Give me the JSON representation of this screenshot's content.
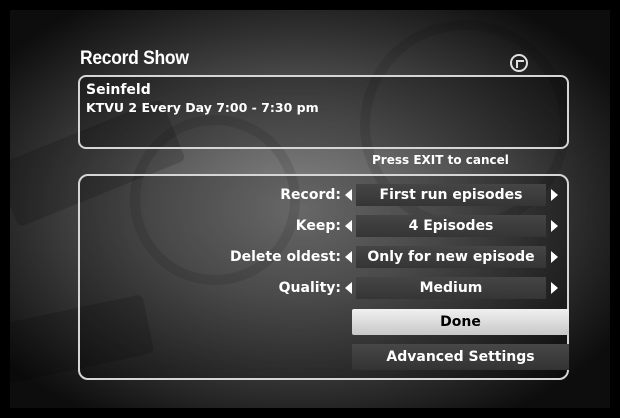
{
  "screen": {
    "title": "Record Show",
    "logo_icon": "tivo-logo-icon"
  },
  "show": {
    "name": "Seinfeld",
    "schedule": "KTVU 2 Every Day 7:00 - 7:30 pm"
  },
  "hint": "Press EXIT to cancel",
  "settings": [
    {
      "label": "Record:",
      "value": "First run episodes"
    },
    {
      "label": "Keep:",
      "value": "4 Episodes"
    },
    {
      "label": "Delete oldest:",
      "value": "Only for new episode"
    },
    {
      "label": "Quality:",
      "value": "Medium"
    }
  ],
  "buttons": {
    "done": "Done",
    "advanced": "Advanced Settings"
  },
  "colors": {
    "selected_button": "#e0e0e0",
    "border": "#d6d6d6"
  }
}
